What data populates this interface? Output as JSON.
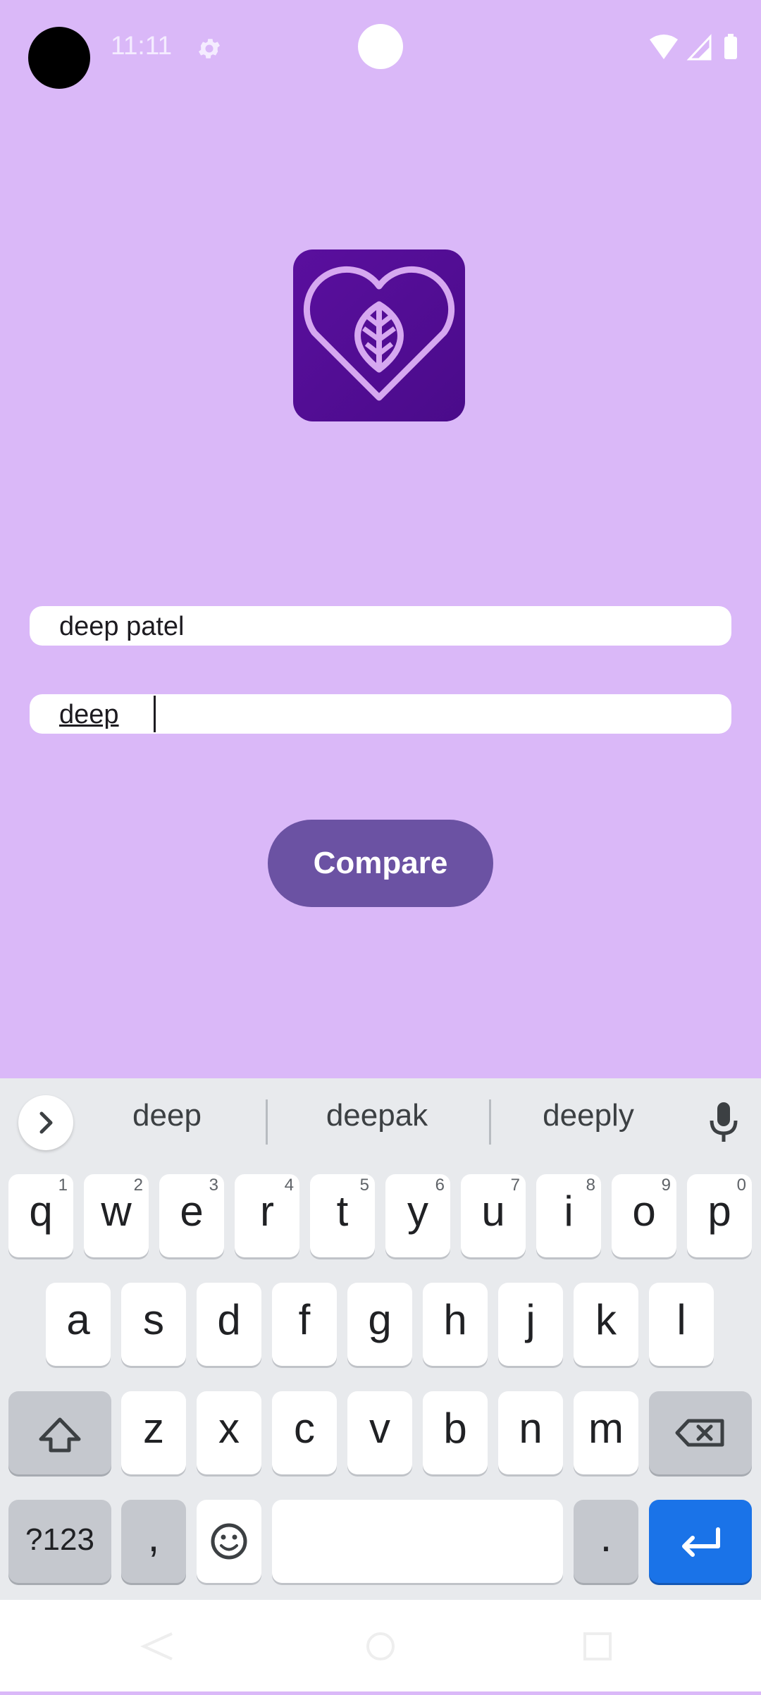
{
  "status_bar": {
    "time": "11:11"
  },
  "app": {
    "logo_icon": "heart-leaf-icon",
    "input1_value": "deep patel",
    "input2_value": "deep",
    "compare_label": "Compare",
    "accent": "#6b52a3",
    "background": "#dab8f8"
  },
  "keyboard": {
    "suggestions": [
      "deep",
      "deepak",
      "deeply"
    ],
    "row1": [
      {
        "label": "q",
        "hint": "1"
      },
      {
        "label": "w",
        "hint": "2"
      },
      {
        "label": "e",
        "hint": "3"
      },
      {
        "label": "r",
        "hint": "4"
      },
      {
        "label": "t",
        "hint": "5"
      },
      {
        "label": "y",
        "hint": "6"
      },
      {
        "label": "u",
        "hint": "7"
      },
      {
        "label": "i",
        "hint": "8"
      },
      {
        "label": "o",
        "hint": "9"
      },
      {
        "label": "p",
        "hint": "0"
      }
    ],
    "row2": [
      "a",
      "s",
      "d",
      "f",
      "g",
      "h",
      "j",
      "k",
      "l"
    ],
    "row3": [
      "z",
      "x",
      "c",
      "v",
      "b",
      "n",
      "m"
    ],
    "symbols_label": "?123",
    "comma_label": ",",
    "period_label": "."
  }
}
